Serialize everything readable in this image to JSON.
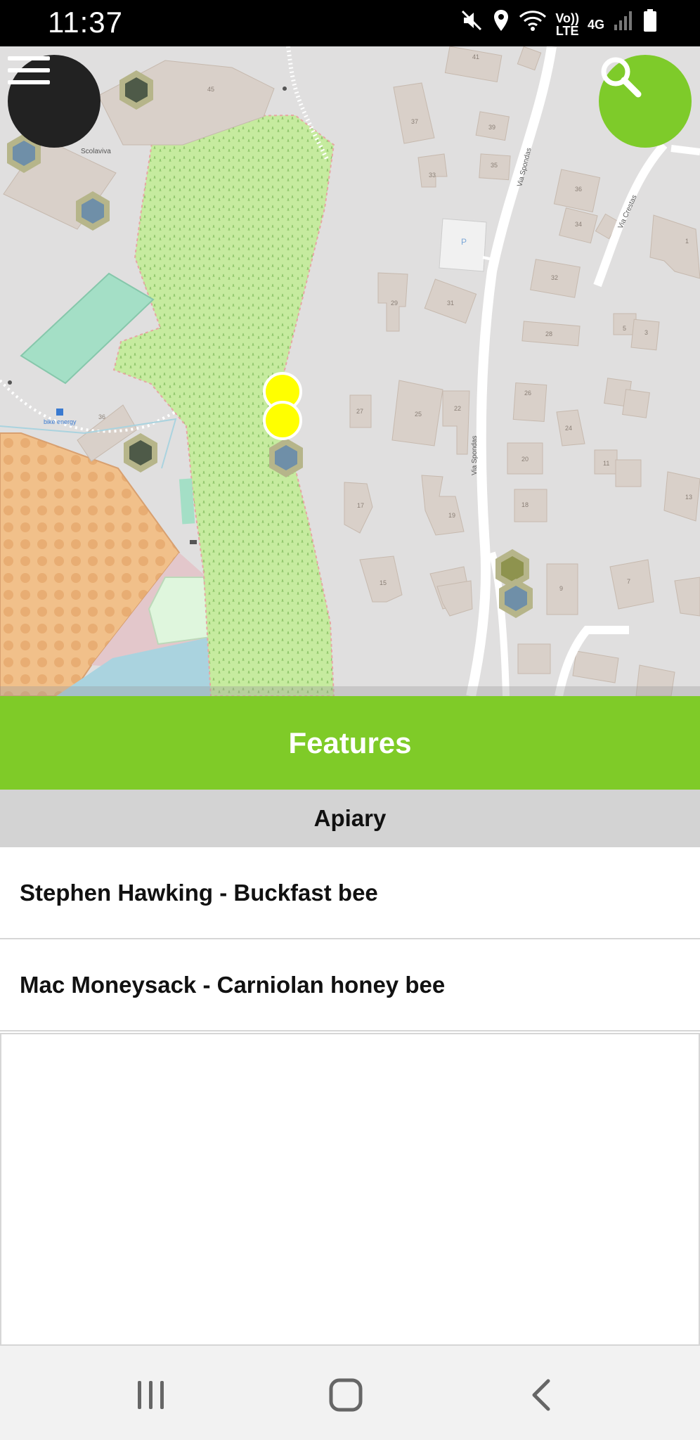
{
  "status_bar": {
    "time": "11:37",
    "icons": [
      "mute-icon",
      "location-icon",
      "wifi-icon",
      "volte-icon",
      "4g-icon",
      "signal-icon",
      "battery-icon"
    ],
    "volte_label": "Vo))\nLTE",
    "net_label": "4G"
  },
  "map": {
    "markers": [
      {
        "type": "apiary-selected",
        "color": "#ffff00"
      },
      {
        "type": "apiary-selected",
        "color": "#ffff00"
      }
    ],
    "labels": {
      "scolaviva": "Scolaviva",
      "via_spondas_1": "Via Spondas",
      "via_spondas_2": "Via Spondas",
      "via_crestas": "Via Crestas",
      "parking": "P",
      "bike_energy": "bike energy"
    },
    "house_numbers": [
      "45",
      "41",
      "37",
      "39",
      "35",
      "33",
      "36",
      "34",
      "32",
      "29",
      "31",
      "28",
      "27",
      "25",
      "26",
      "24",
      "22",
      "20",
      "18",
      "17",
      "19",
      "15",
      "13",
      "11",
      "9",
      "7",
      "5",
      "3",
      "1",
      "36"
    ]
  },
  "menu_button": {
    "icon": "hamburger-icon"
  },
  "search_button": {
    "icon": "search-icon"
  },
  "features": {
    "title": "Features",
    "section": "Apiary",
    "items": [
      {
        "label": "Stephen Hawking - Buckfast bee"
      },
      {
        "label": "Mac Moneysack - Carniolan honey bee"
      }
    ]
  },
  "nav_bar": {
    "recents_icon": "recents-icon",
    "home_icon": "home-icon",
    "back_icon": "back-icon"
  },
  "colors": {
    "accent": "#7fcb28",
    "selected_marker": "#ffff00",
    "hex_marker_blue": "#6f8fa8",
    "hex_marker_dark": "#4e5a48"
  }
}
